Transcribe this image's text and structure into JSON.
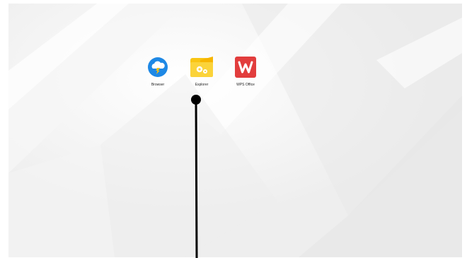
{
  "desktop": {
    "background_color": "#f2f2f2",
    "apps": [
      {
        "label": "Browser",
        "icon": "browser-icon",
        "color": "#1e88e5"
      },
      {
        "label": "Explorer",
        "icon": "explorer-icon",
        "color": "#f9c513"
      },
      {
        "label": "WPS Office",
        "icon": "wps-office-icon",
        "color": "#e23d3d"
      }
    ]
  },
  "overlay": {
    "pointer_color": "#000000"
  }
}
